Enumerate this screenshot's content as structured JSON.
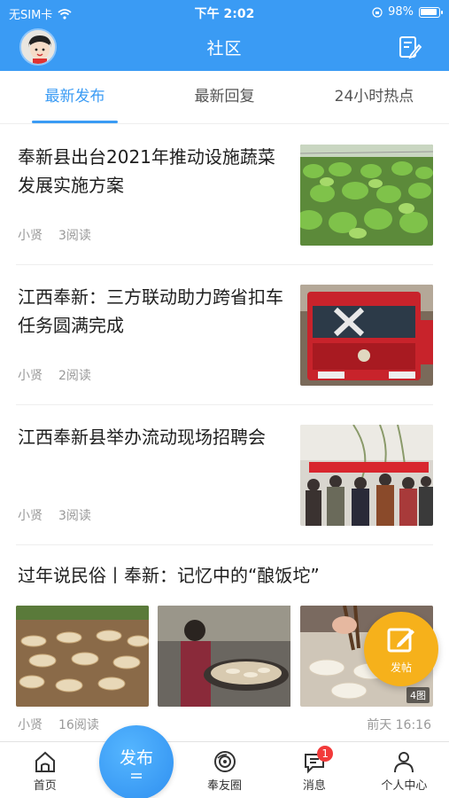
{
  "status": {
    "carrier": "无SIM卡",
    "time": "下午 2:02",
    "battery": "98%"
  },
  "header": {
    "title": "社区"
  },
  "tabs": [
    {
      "label": "最新发布"
    },
    {
      "label": "最新回复"
    },
    {
      "label": "24小时热点"
    }
  ],
  "feed": [
    {
      "title": "奉新县出台2021年推动设施蔬菜发展实施方案",
      "author": "小贤",
      "reads": "3阅读"
    },
    {
      "title": "江西奉新：三方联动助力跨省扣车 任务圆满完成",
      "author": "小贤",
      "reads": "2阅读"
    },
    {
      "title": "江西奉新县举办流动现场招聘会",
      "author": "小贤",
      "reads": "3阅读"
    },
    {
      "title": "过年说民俗丨奉新：记忆中的“酿饭坨”",
      "author": "小贤",
      "reads": "16阅读",
      "time": "前天 16:16",
      "image_count": "4图"
    }
  ],
  "fab": {
    "label": "发帖"
  },
  "bottom_nav": {
    "home": "首页",
    "post": "发布",
    "circle": "奉友圈",
    "messages": "消息",
    "messages_badge": "1",
    "profile": "个人中心"
  },
  "colors": {
    "accent": "#3a9bf4",
    "fab": "#f6b11b",
    "badge": "#f23a3a"
  }
}
